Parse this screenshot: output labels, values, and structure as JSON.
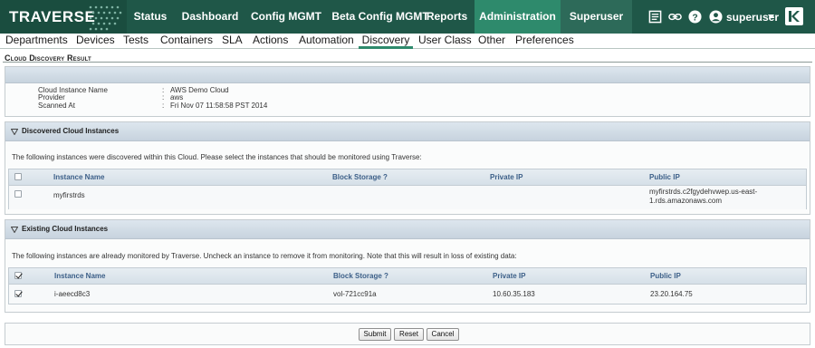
{
  "topnav": {
    "logo": "TRAVERSE",
    "items": [
      "Status",
      "Dashboard",
      "Config MGMT",
      "Beta Config MGMT",
      "Reports",
      "Administration",
      "Superuser"
    ],
    "active": "Administration",
    "user": "superuser"
  },
  "icons": [
    "notes-icon",
    "link-icon",
    "help-icon",
    "user-icon",
    "caret-down-icon",
    "k-brand-icon"
  ],
  "subnav": {
    "items": [
      "Departments",
      "Devices",
      "Tests",
      "Containers",
      "SLA",
      "Actions",
      "Automation",
      "Discovery",
      "User Class",
      "Other",
      "Preferences"
    ],
    "active": "Discovery"
  },
  "page": {
    "title": "Cloud Discovery Result"
  },
  "summary": {
    "rows": [
      {
        "label": "Cloud Instance Name",
        "sep": ":",
        "value": "AWS Demo Cloud"
      },
      {
        "label": "Provider",
        "sep": ":",
        "value": "aws"
      },
      {
        "label": "Scanned At",
        "sep": ":",
        "value": "Fri Nov 07 11:58:58 PST 2014"
      }
    ]
  },
  "discovered": {
    "heading": "Discovered Cloud Instances",
    "description": "The following instances were discovered within this Cloud. Please select the instances that should be monitored using Traverse:",
    "columns": [
      "Instance Name",
      "Block Storage ?",
      "Private IP",
      "Public IP"
    ],
    "rows": [
      {
        "checked": false,
        "name": "myfirstrds",
        "storage": "",
        "private_ip": "",
        "public_ip_line1": "myfirstrds.c2fgydehvwep.us-east-",
        "public_ip_line2": "1.rds.amazonaws.com"
      }
    ]
  },
  "existing": {
    "heading": "Existing Cloud Instances",
    "description": "The following instances are already monitored by Traverse. Uncheck an instance to remove it from monitoring. Note that this will result in loss of existing data:",
    "columns": [
      "Instance Name",
      "Block Storage ?",
      "Private IP",
      "Public IP"
    ],
    "rows": [
      {
        "checked": true,
        "name": "i-aeecd8c3",
        "storage": "vol-721cc91a",
        "private_ip": "10.60.35.183",
        "public_ip": "23.20.164.75"
      }
    ]
  },
  "buttons": {
    "submit": "Submit",
    "reset": "Reset",
    "cancel": "Cancel"
  },
  "colors": {
    "topbar": "#1f5748",
    "active_tab": "#2e8a6c",
    "grid_header_text": "#3c5f88"
  }
}
